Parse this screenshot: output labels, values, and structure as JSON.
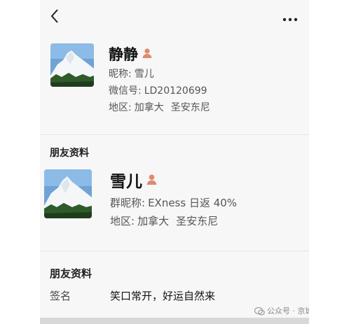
{
  "nav": {
    "back_icon": "chevron-left-icon",
    "more_icon": "more-dots-icon"
  },
  "profile": {
    "name": "静静",
    "nickname_label": "昵称:",
    "nickname": "雪儿",
    "wechat_id_label": "微信号:",
    "wechat_id": "LD20120699",
    "region_label": "地区:",
    "region_country": "加拿大",
    "region_city": "圣安东尼"
  },
  "friend_profile_1": {
    "title": "朋友资料",
    "name": "雪儿",
    "group_nick_label": "群昵称:",
    "group_nick": "EXness 日返  40%",
    "region_label": "地区:",
    "region_country": "加拿大",
    "region_city": "圣安东尼"
  },
  "friend_profile_2": {
    "title": "朋友资料",
    "signature_label": "签名",
    "signature": "笑口常开，好运自然来"
  },
  "watermark": {
    "text": "公众号 · 京城沈王爷"
  },
  "colors": {
    "person_icon": "#e0896f",
    "background": "#f7f7f7",
    "divider": "#e6e6e6"
  }
}
